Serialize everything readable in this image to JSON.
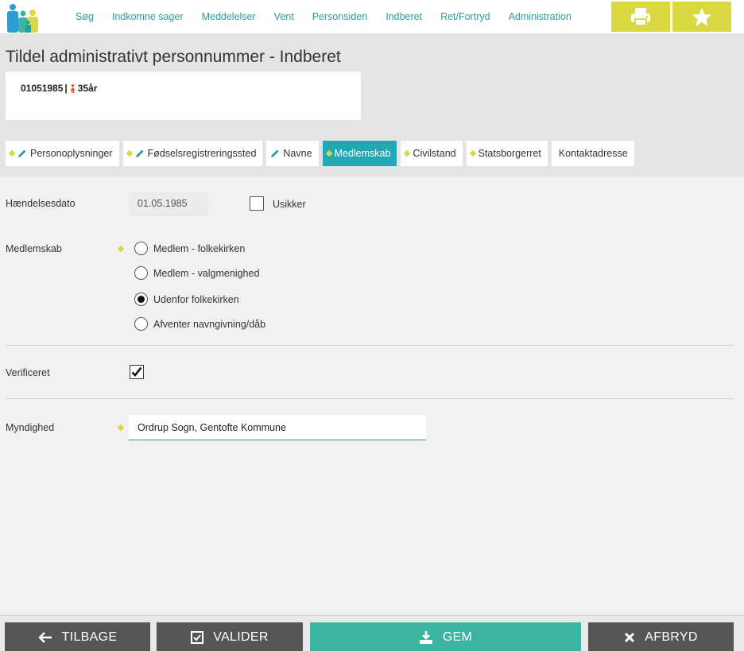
{
  "nav": {
    "items": [
      "Søg",
      "Indkomne sager",
      "Meddelelser",
      "Vent",
      "Personsiden",
      "Indberet",
      "Ret/Fortryd",
      "Administration"
    ]
  },
  "header": {
    "title": "Tildel administrativt personnummer - Indberet",
    "person_id": "01051985",
    "separator": "|",
    "age": "35år"
  },
  "tabs": [
    {
      "label": "Personoplysninger"
    },
    {
      "label": "Fødselsregistreringssted"
    },
    {
      "label": "Navne"
    },
    {
      "label": "Medlemskab"
    },
    {
      "label": "Civilstand"
    },
    {
      "label": "Statsborgerret"
    },
    {
      "label": "Kontaktadresse"
    }
  ],
  "form": {
    "event_date_label": "Hændelsesdato",
    "event_date_value": "01.05.1985",
    "uncertain_label": "Usikker",
    "membership_label": "Medlemskab",
    "membership_options": [
      "Medlem - folkekirken",
      "Medlem - valgmenighed",
      "Udenfor folkekirken",
      "Afventer navngivning/dåb"
    ],
    "membership_selected": "Udenfor folkekirken",
    "verified_label": "Verificeret",
    "authority_label": "Myndighed",
    "authority_value": "Ordrup Sogn, Gentofte Kommune"
  },
  "footer": {
    "back": "TILBAGE",
    "validate": "VALIDER",
    "save": "GEM",
    "cancel": "AFBRYD"
  },
  "colors": {
    "accent": "#2a9d9b",
    "tab_active": "#22a8b3",
    "yellow": "#d9d842",
    "save": "#3db3a2",
    "dark_button": "#555555"
  },
  "icons": {
    "logo": "family-logo-icon",
    "print": "printer-icon",
    "favorite": "star-icon",
    "edit": "pencil-icon",
    "required": "diamond-icon",
    "back": "arrow-left-icon",
    "validate": "check-square-icon",
    "save": "download-icon",
    "cancel": "x-icon"
  }
}
